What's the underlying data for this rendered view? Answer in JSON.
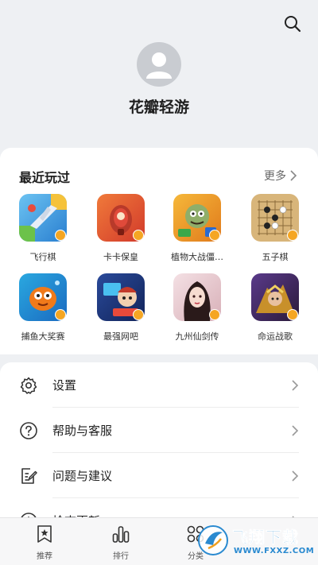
{
  "profile": {
    "name": "花瓣轻游"
  },
  "recent": {
    "title": "最近玩过",
    "more_label": "更多",
    "games": [
      {
        "name": "飞行棋",
        "color": "#3a9be0"
      },
      {
        "name": "卡卡保皇",
        "color": "#e5533b"
      },
      {
        "name": "植物大战僵…",
        "color": "#f09a1f"
      },
      {
        "name": "五子棋",
        "color": "#c9a05a"
      },
      {
        "name": "捕鱼大奖赛",
        "color": "#f08a1a"
      },
      {
        "name": "最强网吧",
        "color": "#1f3f8a"
      },
      {
        "name": "九州仙剑传",
        "color": "#e8c6c6"
      },
      {
        "name": "命运战歌",
        "color": "#3a2a5a"
      }
    ]
  },
  "menu": {
    "items": [
      {
        "label": "设置",
        "icon": "gear-icon"
      },
      {
        "label": "帮助与客服",
        "icon": "help-icon"
      },
      {
        "label": "问题与建议",
        "icon": "feedback-icon"
      },
      {
        "label": "检查更新",
        "icon": "update-icon"
      }
    ]
  },
  "nav": {
    "items": [
      {
        "label": "推荐",
        "icon": "recommend-icon"
      },
      {
        "label": "排行",
        "icon": "ranking-icon"
      },
      {
        "label": "分类",
        "icon": "category-icon"
      }
    ]
  },
  "watermark": {
    "text": "飞翔下载",
    "url": "WWW.FXXZ.COM"
  }
}
